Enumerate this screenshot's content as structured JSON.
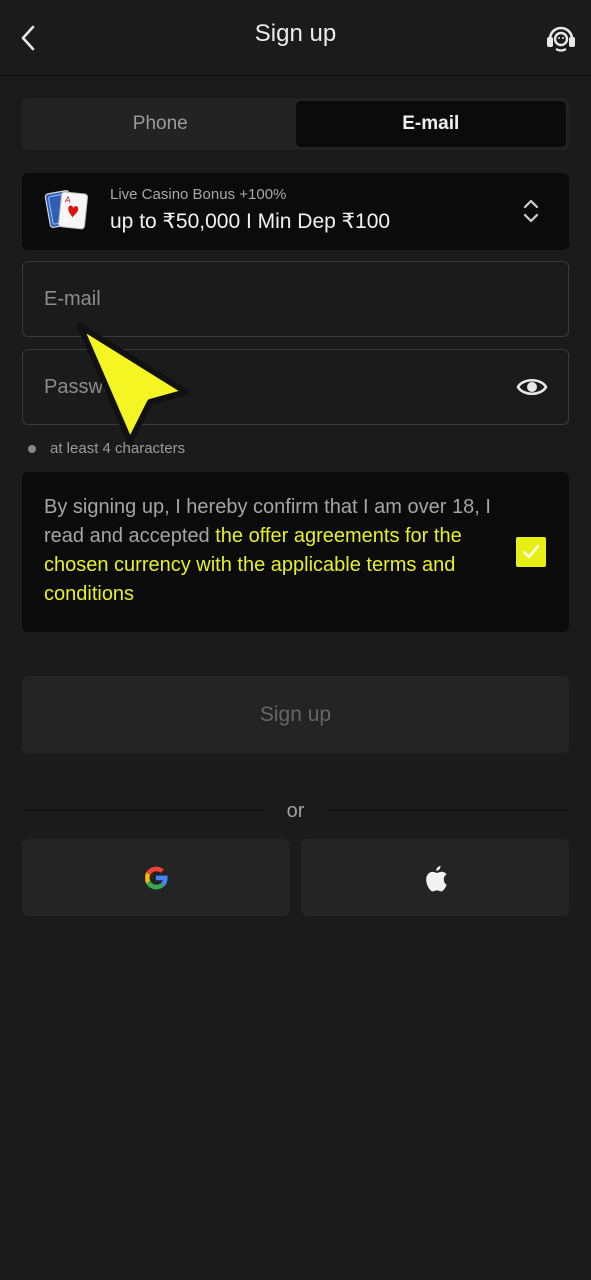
{
  "header": {
    "title": "Sign up",
    "back_icon": "chevron-left-icon",
    "support_icon": "headset-icon"
  },
  "tabs": [
    {
      "label": "Phone",
      "active": false
    },
    {
      "label": "E-mail",
      "active": true
    }
  ],
  "bonus": {
    "subtitle": "Live Casino Bonus +100%",
    "title": "up to ₹50,000 I Min Dep ₹100",
    "icon": "playing-cards-icon",
    "selector_icon": "chevron-up-down-icon"
  },
  "email_field": {
    "placeholder": "E-mail",
    "value": ""
  },
  "password_field": {
    "placeholder": "Password",
    "value": "",
    "toggle_icon": "eye-icon"
  },
  "password_hint": "at least 4 characters",
  "terms": {
    "text": "By signing up, I hereby confirm that I am over 18, I read and accepted ",
    "link": "the offer agreements for the chosen currency with the applicable terms and conditions",
    "checked": true
  },
  "signup_button": "Sign up",
  "divider_text": "or",
  "social": [
    {
      "name": "google-icon"
    },
    {
      "name": "apple-icon"
    }
  ],
  "colors": {
    "accent": "#e6ef16",
    "background": "#1b1b1b",
    "panel": "#0b0b0b",
    "button": "#242424"
  }
}
